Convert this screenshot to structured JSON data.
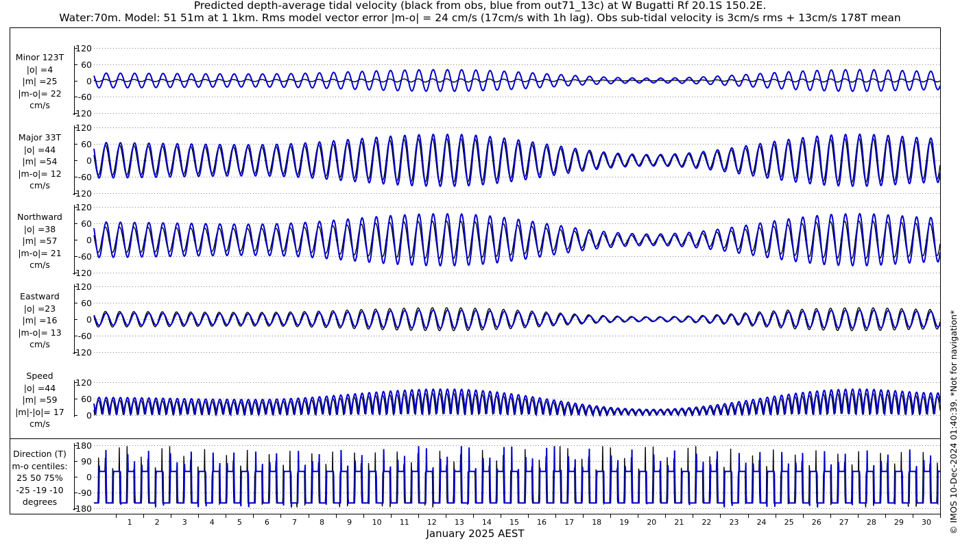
{
  "title_line1": "Predicted depth-average tidal velocity (black from obs, blue from out71_13c) at W Bugatti Rf 20.1S 150.2E.",
  "title_line2": "Water:70m. Model: 51 51m at 1 1km. Rms model vector error |m-o| = 24 cm/s (17cm/s with 1h lag). Obs sub-tidal velocity is 3cm/s rms + 13cm/s 178T mean",
  "credit": "© IMOS 10-Dec-2024 01:40:39. *Not for navigation*",
  "colors": {
    "obs": "#000000",
    "model": "#0000cc",
    "grid": "#555555"
  },
  "chart_data": {
    "type": "line",
    "xlabel": "January 2025 AEST",
    "x_ticks": [
      "1",
      "2",
      "3",
      "4",
      "5",
      "6",
      "7",
      "8",
      "9",
      "10",
      "11",
      "12",
      "13",
      "14",
      "15",
      "16",
      "17",
      "18",
      "19",
      "20",
      "21",
      "22",
      "23",
      "24",
      "25",
      "26",
      "27",
      "28",
      "29",
      "30"
    ],
    "xlim_days": [
      0.2,
      31.0
    ],
    "legend_series": [
      "obs (black)",
      "model (blue)"
    ],
    "panels": [
      {
        "id": "minor",
        "labels": [
          "Minor 123T",
          "|o| =4",
          "|m| =25",
          "|m-o|= 22",
          "cm/s"
        ],
        "ylim": [
          -120,
          120
        ],
        "yticks": [
          -120,
          -60,
          0,
          60,
          120
        ],
        "obs_amp": 6,
        "model_amp": 40,
        "kind": "signed"
      },
      {
        "id": "major",
        "labels": [
          "Major 33T",
          "|o| =44",
          "|m| =54",
          "|m-o|= 12",
          "cm/s"
        ],
        "ylim": [
          -120,
          120
        ],
        "yticks": [
          -120,
          -60,
          0,
          60,
          120
        ],
        "obs_amp": 80,
        "model_amp": 95,
        "kind": "signed"
      },
      {
        "id": "north",
        "labels": [
          "Northward",
          "|o| =38",
          "|m| =57",
          "|m-o|= 21",
          "cm/s"
        ],
        "ylim": [
          -120,
          120
        ],
        "yticks": [
          -120,
          -60,
          0,
          60,
          120
        ],
        "obs_amp": 68,
        "model_amp": 95,
        "kind": "signed"
      },
      {
        "id": "east",
        "labels": [
          "Eastward",
          "|o| =23",
          "|m| =16",
          "|m-o|= 13",
          "cm/s"
        ],
        "ylim": [
          -120,
          120
        ],
        "yticks": [
          -120,
          -60,
          0,
          60,
          120
        ],
        "obs_amp": 42,
        "model_amp": 33,
        "kind": "signed"
      },
      {
        "id": "speed",
        "labels": [
          "Speed",
          "|o| =44",
          "|m| =59",
          "|m|-|o|= 17",
          "cm/s"
        ],
        "ylim": [
          0,
          120
        ],
        "yticks": [
          0,
          60,
          120
        ],
        "obs_amp": 80,
        "model_amp": 95,
        "kind": "speed"
      },
      {
        "id": "dir",
        "labels": [
          "Direction (T)",
          "m-o centiles:",
          "25  50  75%",
          "-25 -19 -10",
          "degrees"
        ],
        "ylim": [
          -180,
          180
        ],
        "yticks": [
          -180,
          -90,
          0,
          90,
          180
        ],
        "kind": "direction"
      }
    ],
    "tidal_period_hours": 12.42,
    "spring_neap_envelope": {
      "days": [
        0.2,
        6,
        13,
        20.5,
        28,
        31
      ],
      "factor": [
        0.68,
        0.6,
        1.0,
        0.22,
        1.0,
        0.85
      ]
    }
  }
}
